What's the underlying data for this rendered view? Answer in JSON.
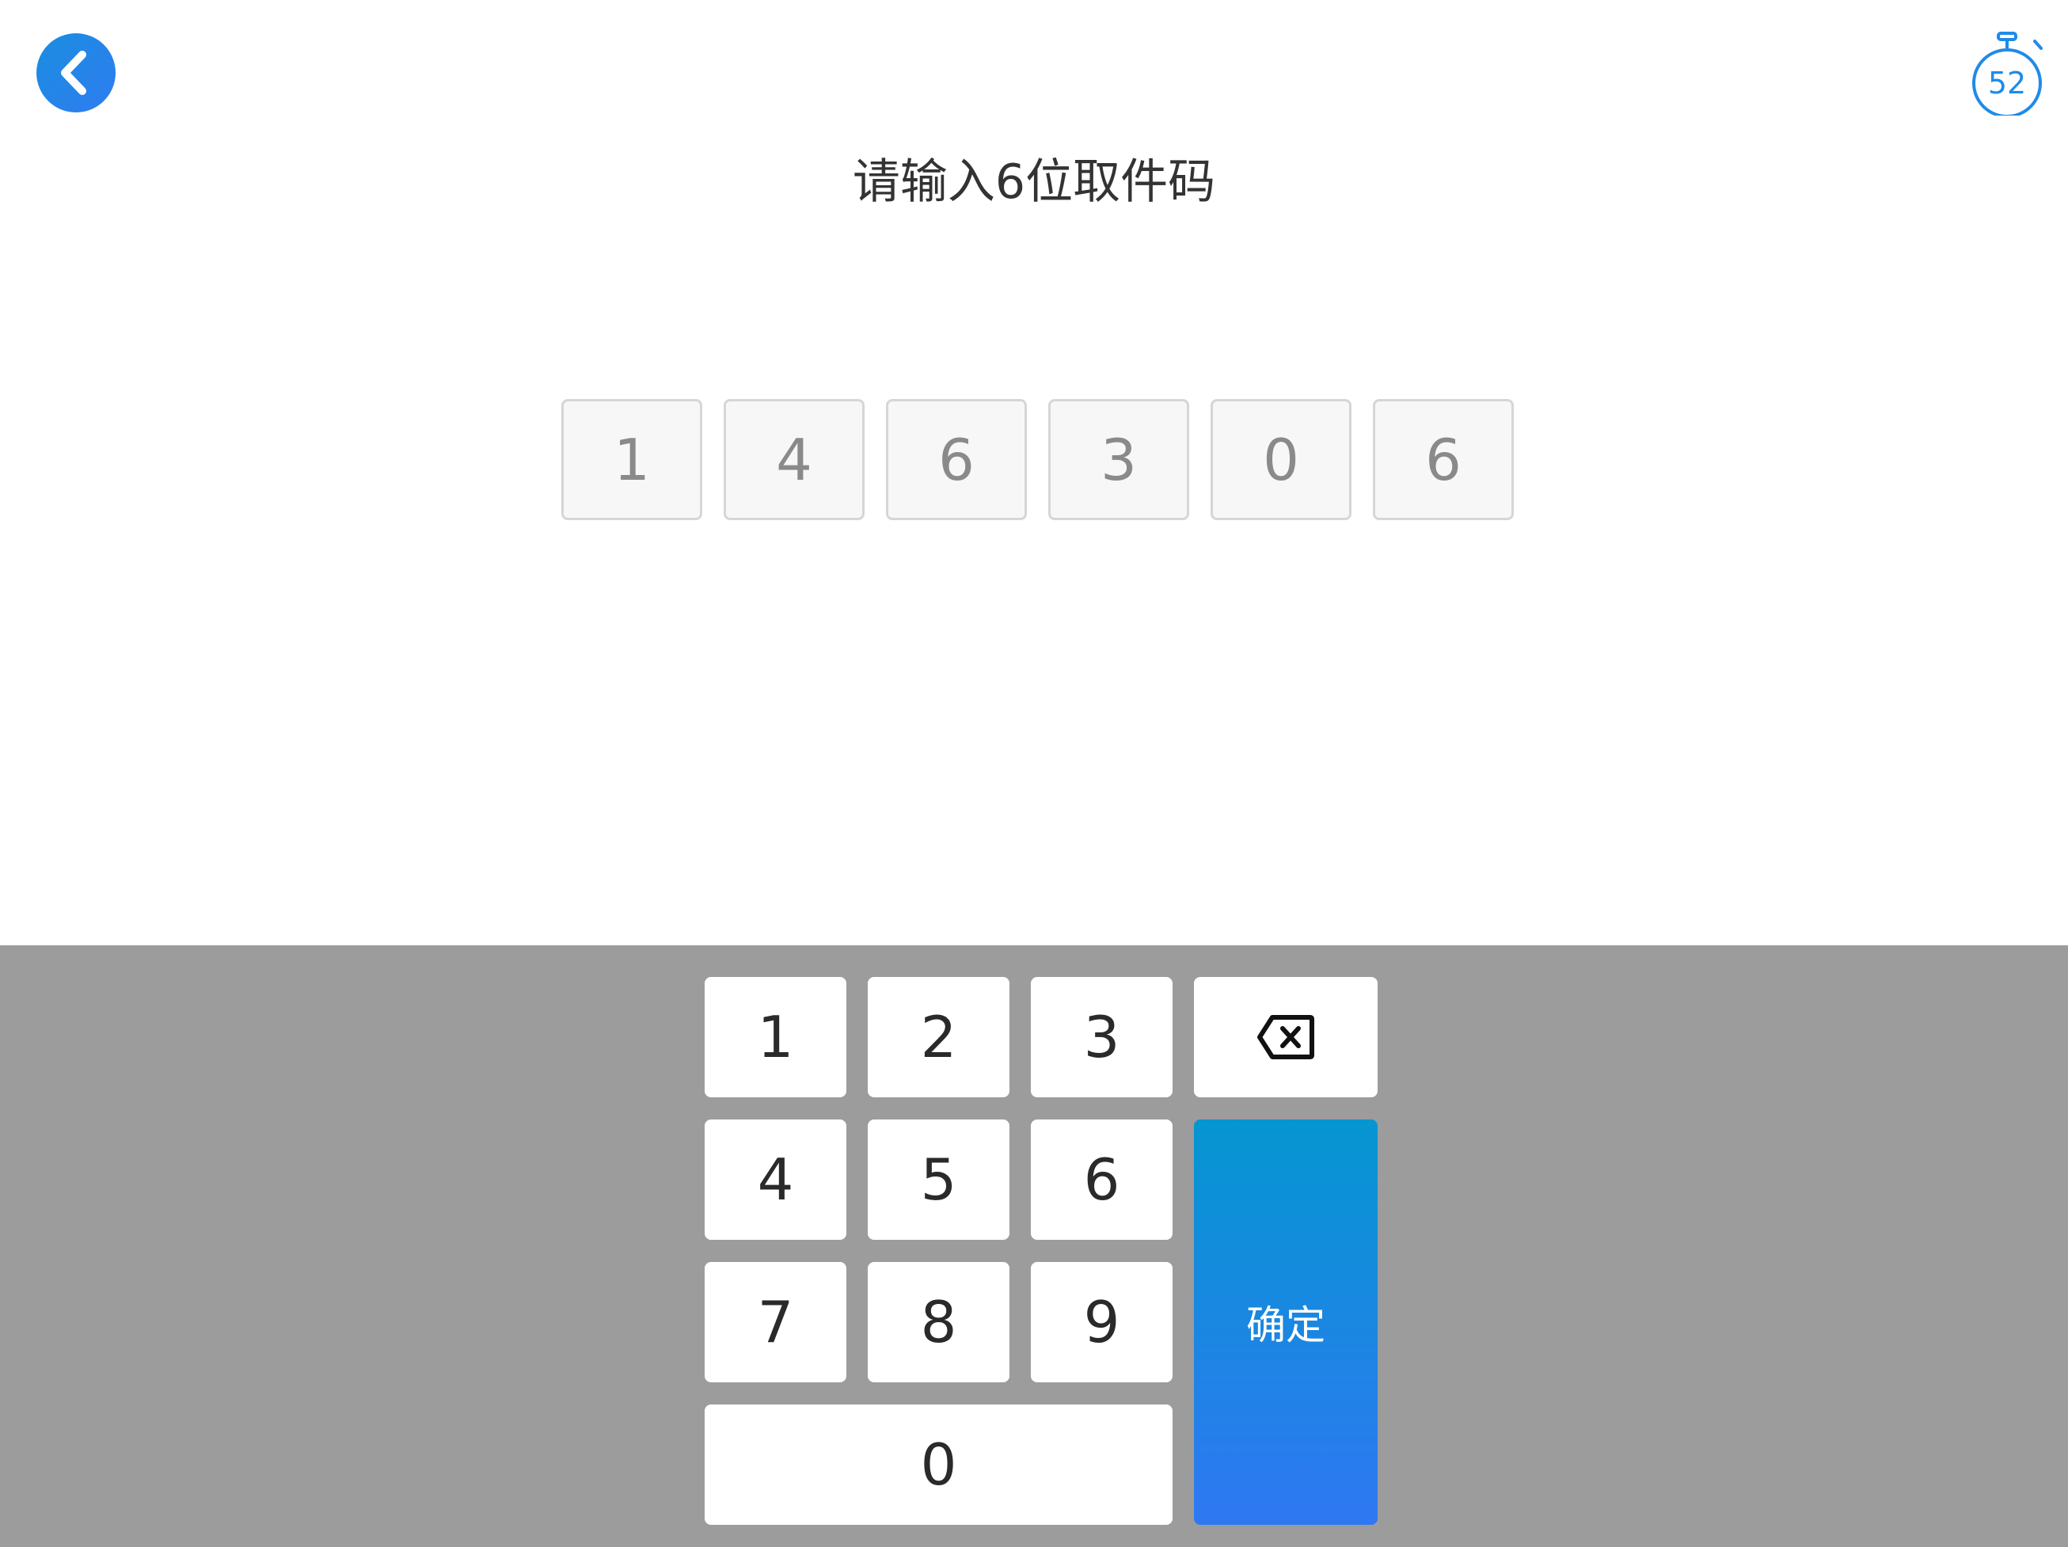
{
  "header": {
    "title": "请输入6位取件码",
    "timer_value": "52",
    "back_icon": "chevron-left-icon",
    "timer_icon": "stopwatch-icon",
    "accent_color": "#1f8be8"
  },
  "code": {
    "digits": [
      "1",
      "4",
      "6",
      "3",
      "0",
      "6"
    ]
  },
  "keypad": {
    "key_1": "1",
    "key_2": "2",
    "key_3": "3",
    "key_4": "4",
    "key_5": "5",
    "key_6": "6",
    "key_7": "7",
    "key_8": "8",
    "key_9": "9",
    "key_0": "0",
    "backspace_icon": "backspace-icon",
    "confirm_label": "确定",
    "background_color": "#9c9c9c",
    "confirm_gradient": [
      "#0596d1",
      "#2f78f2"
    ]
  }
}
